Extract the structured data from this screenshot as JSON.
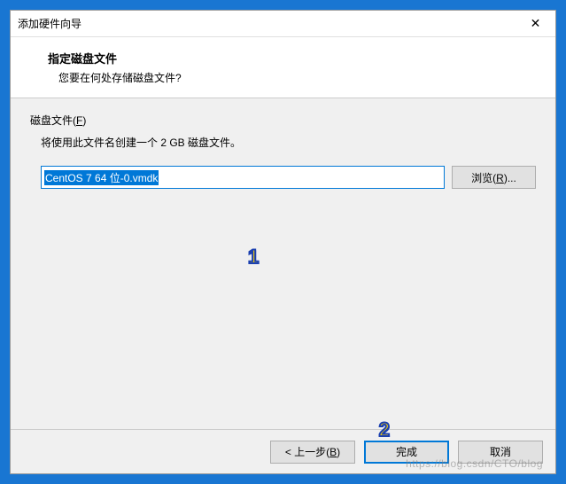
{
  "titlebar": {
    "title": "添加硬件向导",
    "close": "✕"
  },
  "header": {
    "title": "指定磁盘文件",
    "subtitle": "您要在何处存储磁盘文件?"
  },
  "body": {
    "section_label_prefix": "磁盘文件(",
    "section_label_mnemonic": "F",
    "section_label_suffix": ")",
    "description": "将使用此文件名创建一个 2 GB 磁盘文件。",
    "file_value": "CentOS 7 64 位-0.vmdk",
    "browse_prefix": "浏览(",
    "browse_mnemonic": "R",
    "browse_suffix": ")..."
  },
  "buttons": {
    "back_prefix": "< 上一步(",
    "back_mnemonic": "B",
    "back_suffix": ")",
    "finish": "完成",
    "cancel": "取消"
  },
  "markers": {
    "one": "1",
    "two": "2"
  },
  "watermark": "https://blog.csdn/CTO/blog"
}
